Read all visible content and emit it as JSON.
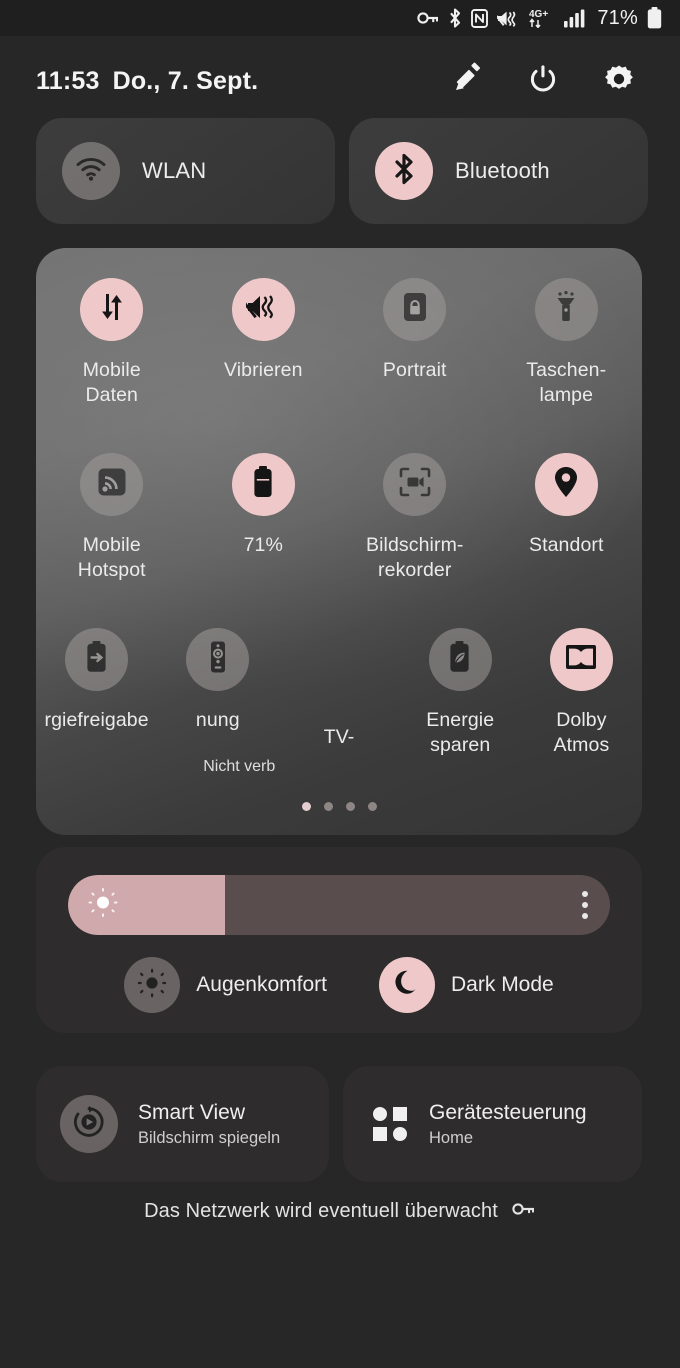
{
  "statusbar": {
    "icons": [
      "vpn-key-icon",
      "bluetooth-icon",
      "nfc-icon",
      "mute-vibrate-icon",
      "4g-plus-icon",
      "signal-bars-icon"
    ],
    "network_type": "4G+",
    "battery_percent": "71%"
  },
  "header": {
    "clock": "11:53",
    "date": "Do., 7. Sept.",
    "buttons": [
      {
        "name": "edit-button",
        "icon": "pencil-icon"
      },
      {
        "name": "power-button",
        "icon": "power-icon"
      },
      {
        "name": "settings-button",
        "icon": "gear-icon"
      }
    ]
  },
  "top_tiles": [
    {
      "label": "WLAN",
      "icon": "wifi-icon",
      "state": "off"
    },
    {
      "label": "Bluetooth",
      "icon": "bluetooth-icon",
      "state": "on"
    }
  ],
  "quick_tiles": [
    [
      {
        "label_lines": [
          "Mobile",
          "Daten"
        ],
        "icon": "mobile-data-icon",
        "state": "on",
        "sub": ""
      },
      {
        "label_lines": [
          "Vibrieren"
        ],
        "icon": "vibrate-icon",
        "state": "on",
        "sub": ""
      },
      {
        "label_lines": [
          "Portrait"
        ],
        "icon": "rotation-lock-icon",
        "state": "off",
        "sub": ""
      },
      {
        "label_lines": [
          "Taschen-",
          "lampe"
        ],
        "icon": "flashlight-icon",
        "state": "off",
        "sub": ""
      }
    ],
    [
      {
        "label_lines": [
          "Mobile",
          "Hotspot"
        ],
        "icon": "hotspot-icon",
        "state": "off",
        "sub": ""
      },
      {
        "label_lines": [
          "71%"
        ],
        "icon": "battery-icon",
        "state": "on",
        "sub": ""
      },
      {
        "label_lines": [
          "Bildschirm-",
          "rekorder"
        ],
        "icon": "screen-recorder-icon",
        "state": "off",
        "sub": ""
      },
      {
        "label_lines": [
          "Standort"
        ],
        "icon": "location-pin-icon",
        "state": "on",
        "sub": ""
      }
    ],
    [
      {
        "label_lines": [
          "rgiefreigabe"
        ],
        "icon": "power-share-icon",
        "state": "off",
        "sub": ""
      },
      {
        "label_lines": [
          "nung"
        ],
        "icon": "remote-control-icon",
        "state": "off",
        "sub": "Nicht verb"
      },
      {
        "label_lines": [
          "TV-"
        ],
        "icon": "",
        "state": "off",
        "sub": ""
      },
      {
        "label_lines": [
          "Energie",
          "sparen"
        ],
        "icon": "power-saving-icon",
        "state": "off",
        "sub": ""
      },
      {
        "label_lines": [
          "Dolby",
          "Atmos"
        ],
        "icon": "dolby-atmos-icon",
        "state": "on",
        "sub": ""
      }
    ]
  ],
  "pager": {
    "total": 4,
    "active": 1
  },
  "brightness": {
    "value_percent": 29,
    "sun_icon": "brightness-sun-icon",
    "menu_icon": "kebab-menu-icon"
  },
  "modes": [
    {
      "label": "Augenkomfort",
      "icon": "eye-comfort-icon",
      "state": "off"
    },
    {
      "label": "Dark Mode",
      "icon": "moon-icon",
      "state": "on"
    }
  ],
  "bottom_tiles": [
    {
      "title": "Smart View",
      "subtitle": "Bildschirm spiegeln",
      "icon": "smart-view-icon"
    },
    {
      "title": "Gerätesteuerung",
      "subtitle": "Home",
      "icon": "device-controls-icon"
    }
  ],
  "footer": {
    "text": "Das Netzwerk wird eventuell überwacht",
    "icon": "vpn-key-icon"
  },
  "colors": {
    "accent_on": "#efc9ca",
    "tile_off": "#a09a9a",
    "panel_dark": "#2e2c2c",
    "background": "#272727"
  }
}
